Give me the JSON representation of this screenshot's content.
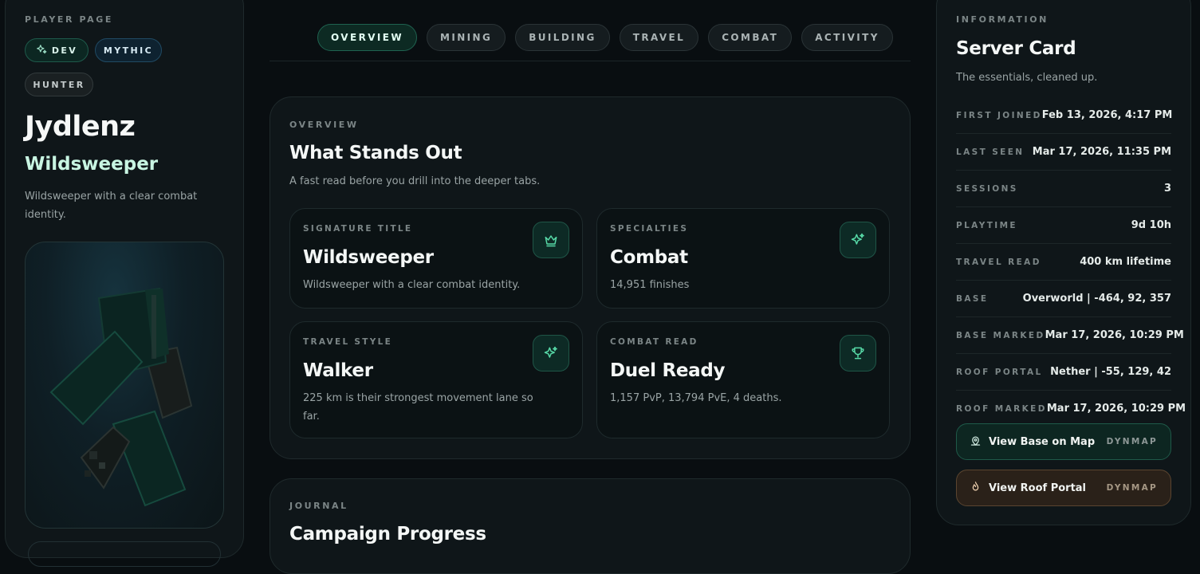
{
  "left": {
    "eyebrow": "PLAYER PAGE",
    "chips": [
      {
        "label": "DEV",
        "icon": "sparkles-icon"
      },
      {
        "label": "MYTHIC"
      },
      {
        "label": "HUNTER"
      }
    ],
    "name": "Jydlenz",
    "title": "Wildsweeper",
    "description": "Wildsweeper with a clear combat identity."
  },
  "tabs": [
    {
      "label": "OVERVIEW",
      "active": true
    },
    {
      "label": "MINING"
    },
    {
      "label": "BUILDING"
    },
    {
      "label": "TRAVEL"
    },
    {
      "label": "COMBAT"
    },
    {
      "label": "ACTIVITY"
    }
  ],
  "overview": {
    "eyebrow": "OVERVIEW",
    "title": "What Stands Out",
    "subtitle": "A fast read before you drill into the deeper tabs.",
    "tiles": [
      {
        "eyebrow": "SIGNATURE TITLE",
        "title": "Wildsweeper",
        "desc": "Wildsweeper with a clear combat identity.",
        "icon": "crown-icon"
      },
      {
        "eyebrow": "SPECIALTIES",
        "title": "Combat",
        "desc": "14,951 finishes",
        "icon": "sparkles-icon"
      },
      {
        "eyebrow": "TRAVEL STYLE",
        "title": "Walker",
        "desc": "225 km is their strongest movement lane so far.",
        "icon": "sparkles-icon"
      },
      {
        "eyebrow": "COMBAT READ",
        "title": "Duel Ready",
        "desc": "1,157 PvP, 13,794 PvE, 4 deaths.",
        "icon": "trophy-icon"
      }
    ]
  },
  "journal": {
    "eyebrow": "JOURNAL",
    "title": "Campaign Progress"
  },
  "info": {
    "eyebrow": "INFORMATION",
    "title": "Server Card",
    "subtitle": "The essentials, cleaned up.",
    "rows": [
      {
        "label": "FIRST JOINED",
        "value": "Feb 13, 2026, 4:17 PM"
      },
      {
        "label": "LAST SEEN",
        "value": "Mar 17, 2026, 11:35 PM"
      },
      {
        "label": "SESSIONS",
        "value": "3"
      },
      {
        "label": "PLAYTIME",
        "value": "9d 10h"
      },
      {
        "label": "TRAVEL READ",
        "value": "400 km lifetime"
      },
      {
        "label": "BASE",
        "value": "Overworld | -464, 92, 357"
      },
      {
        "label": "BASE MARKED",
        "value": "Mar 17, 2026, 10:29 PM"
      },
      {
        "label": "ROOF PORTAL",
        "value": "Nether | -55, 129, 42"
      },
      {
        "label": "ROOF MARKED",
        "value": "Mar 17, 2026, 10:29 PM"
      }
    ],
    "buttons": [
      {
        "label": "View Base on Map",
        "tag": "DYNMAP",
        "icon": "map-pin-icon"
      },
      {
        "label": "View Roof Portal",
        "tag": "DYNMAP",
        "icon": "flame-icon"
      }
    ]
  },
  "colors": {
    "background": "#090e11",
    "panel": "#0f1619",
    "accent_green": "#2fd49a",
    "title_mint": "#c8f5e2",
    "portal_amber": "#e7b88a"
  }
}
